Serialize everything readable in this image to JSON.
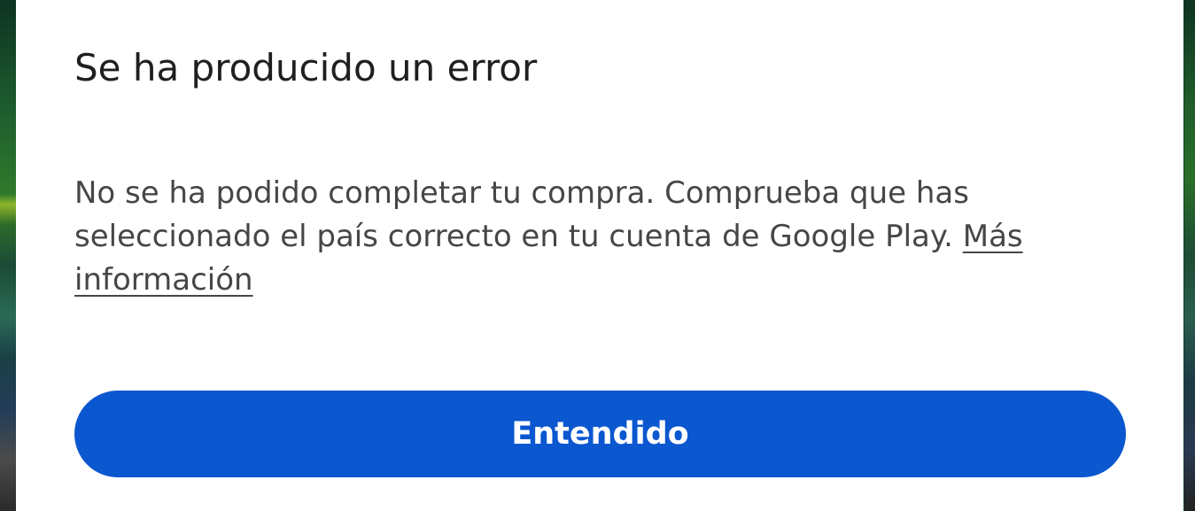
{
  "dialog": {
    "title": "Se ha producido un error",
    "message_text": "No se ha podido completar tu compra. Comprueba que has seleccionado el país correcto en tu cuenta de Google Play. ",
    "learn_more_link": "Más información",
    "ok_button_label": "Entendido"
  },
  "colors": {
    "dialog_background": "#ffffff",
    "title_text": "#1f1f1f",
    "body_text": "#444746",
    "primary_button": "#0b57d0",
    "button_text": "#ffffff"
  }
}
